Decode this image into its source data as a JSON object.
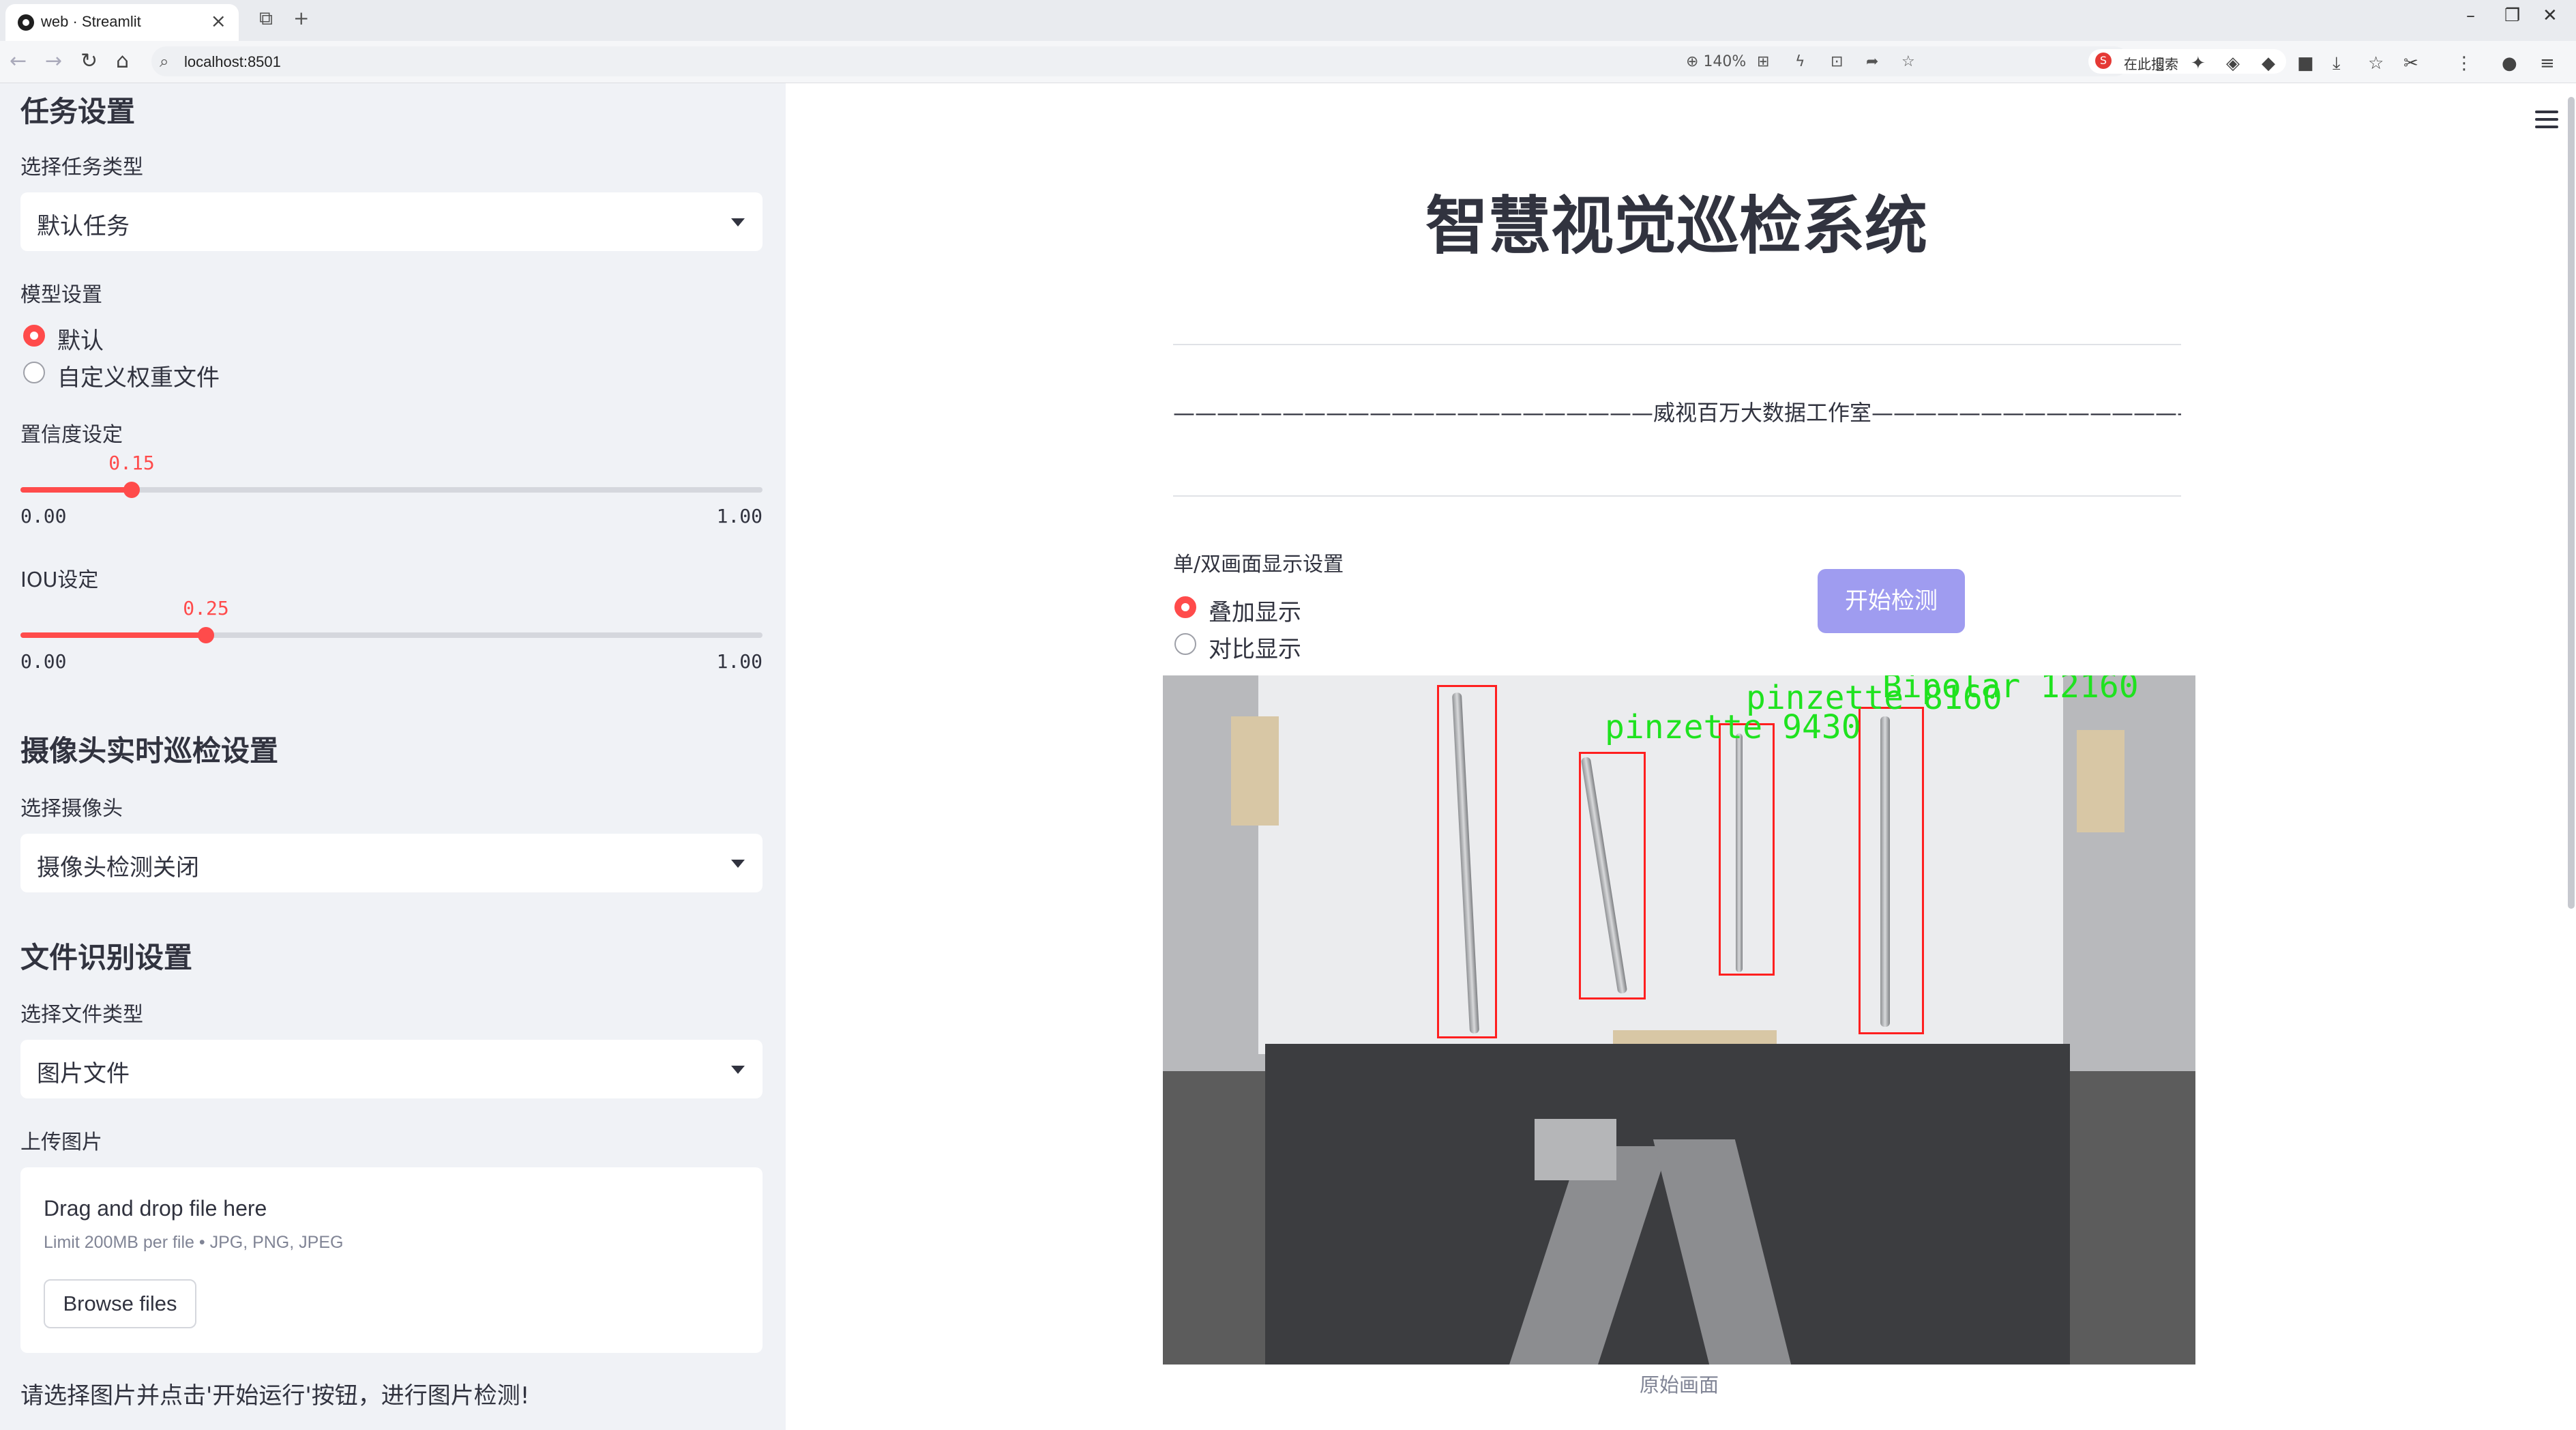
{
  "browser": {
    "tab_title": "web · Streamlit",
    "url": "localhost:8501",
    "zoom": "140%",
    "search_placeholder": "在此搜索"
  },
  "sidebar": {
    "task_section_title": "任务设置",
    "task_type_label": "选择任务类型",
    "task_type_value": "默认任务",
    "model_label": "模型设置",
    "model_options": [
      "默认",
      "自定义权重文件"
    ],
    "model_selected": "默认",
    "confidence": {
      "label": "置信度设定",
      "value": "0.15",
      "min": "0.00",
      "max": "1.00",
      "fraction": 0.15
    },
    "iou": {
      "label": "IOU设定",
      "value": "0.25",
      "min": "0.00",
      "max": "1.00",
      "fraction": 0.25
    },
    "camera_section_title": "摄像头实时巡检设置",
    "camera_label": "选择摄像头",
    "camera_value": "摄像头检测关闭",
    "file_section_title": "文件识别设置",
    "file_type_label": "选择文件类型",
    "file_type_value": "图片文件",
    "upload_label": "上传图片",
    "dropzone_title": "Drag and drop file here",
    "dropzone_limit": "Limit 200MB per file • JPG, PNG, JPEG",
    "browse_label": "Browse files",
    "hint": "请选择图片并点击'开始运行'按钮，进行图片检测!"
  },
  "main": {
    "title": "智慧视觉巡检系统",
    "studio_line": "——————————————————————威视百万大数据工作室————————————————————————",
    "display_label": "单/双画面显示设置",
    "display_options": [
      "叠加显示",
      "对比显示"
    ],
    "display_selected": "叠加显示",
    "start_button": "开始检测",
    "image_caption": "原始画面",
    "detections": [
      {
        "label": ""
      },
      {
        "label": "pinzette 9430"
      },
      {
        "label": "pinzette 8160"
      },
      {
        "label": "Bipolar 12160"
      }
    ]
  },
  "colors": {
    "accent": "#ff4b4b",
    "sidebar_bg": "#f0f2f6",
    "button_bg": "#9f9cf0",
    "box": "#ff1f1f",
    "label": "#1fe21f"
  }
}
